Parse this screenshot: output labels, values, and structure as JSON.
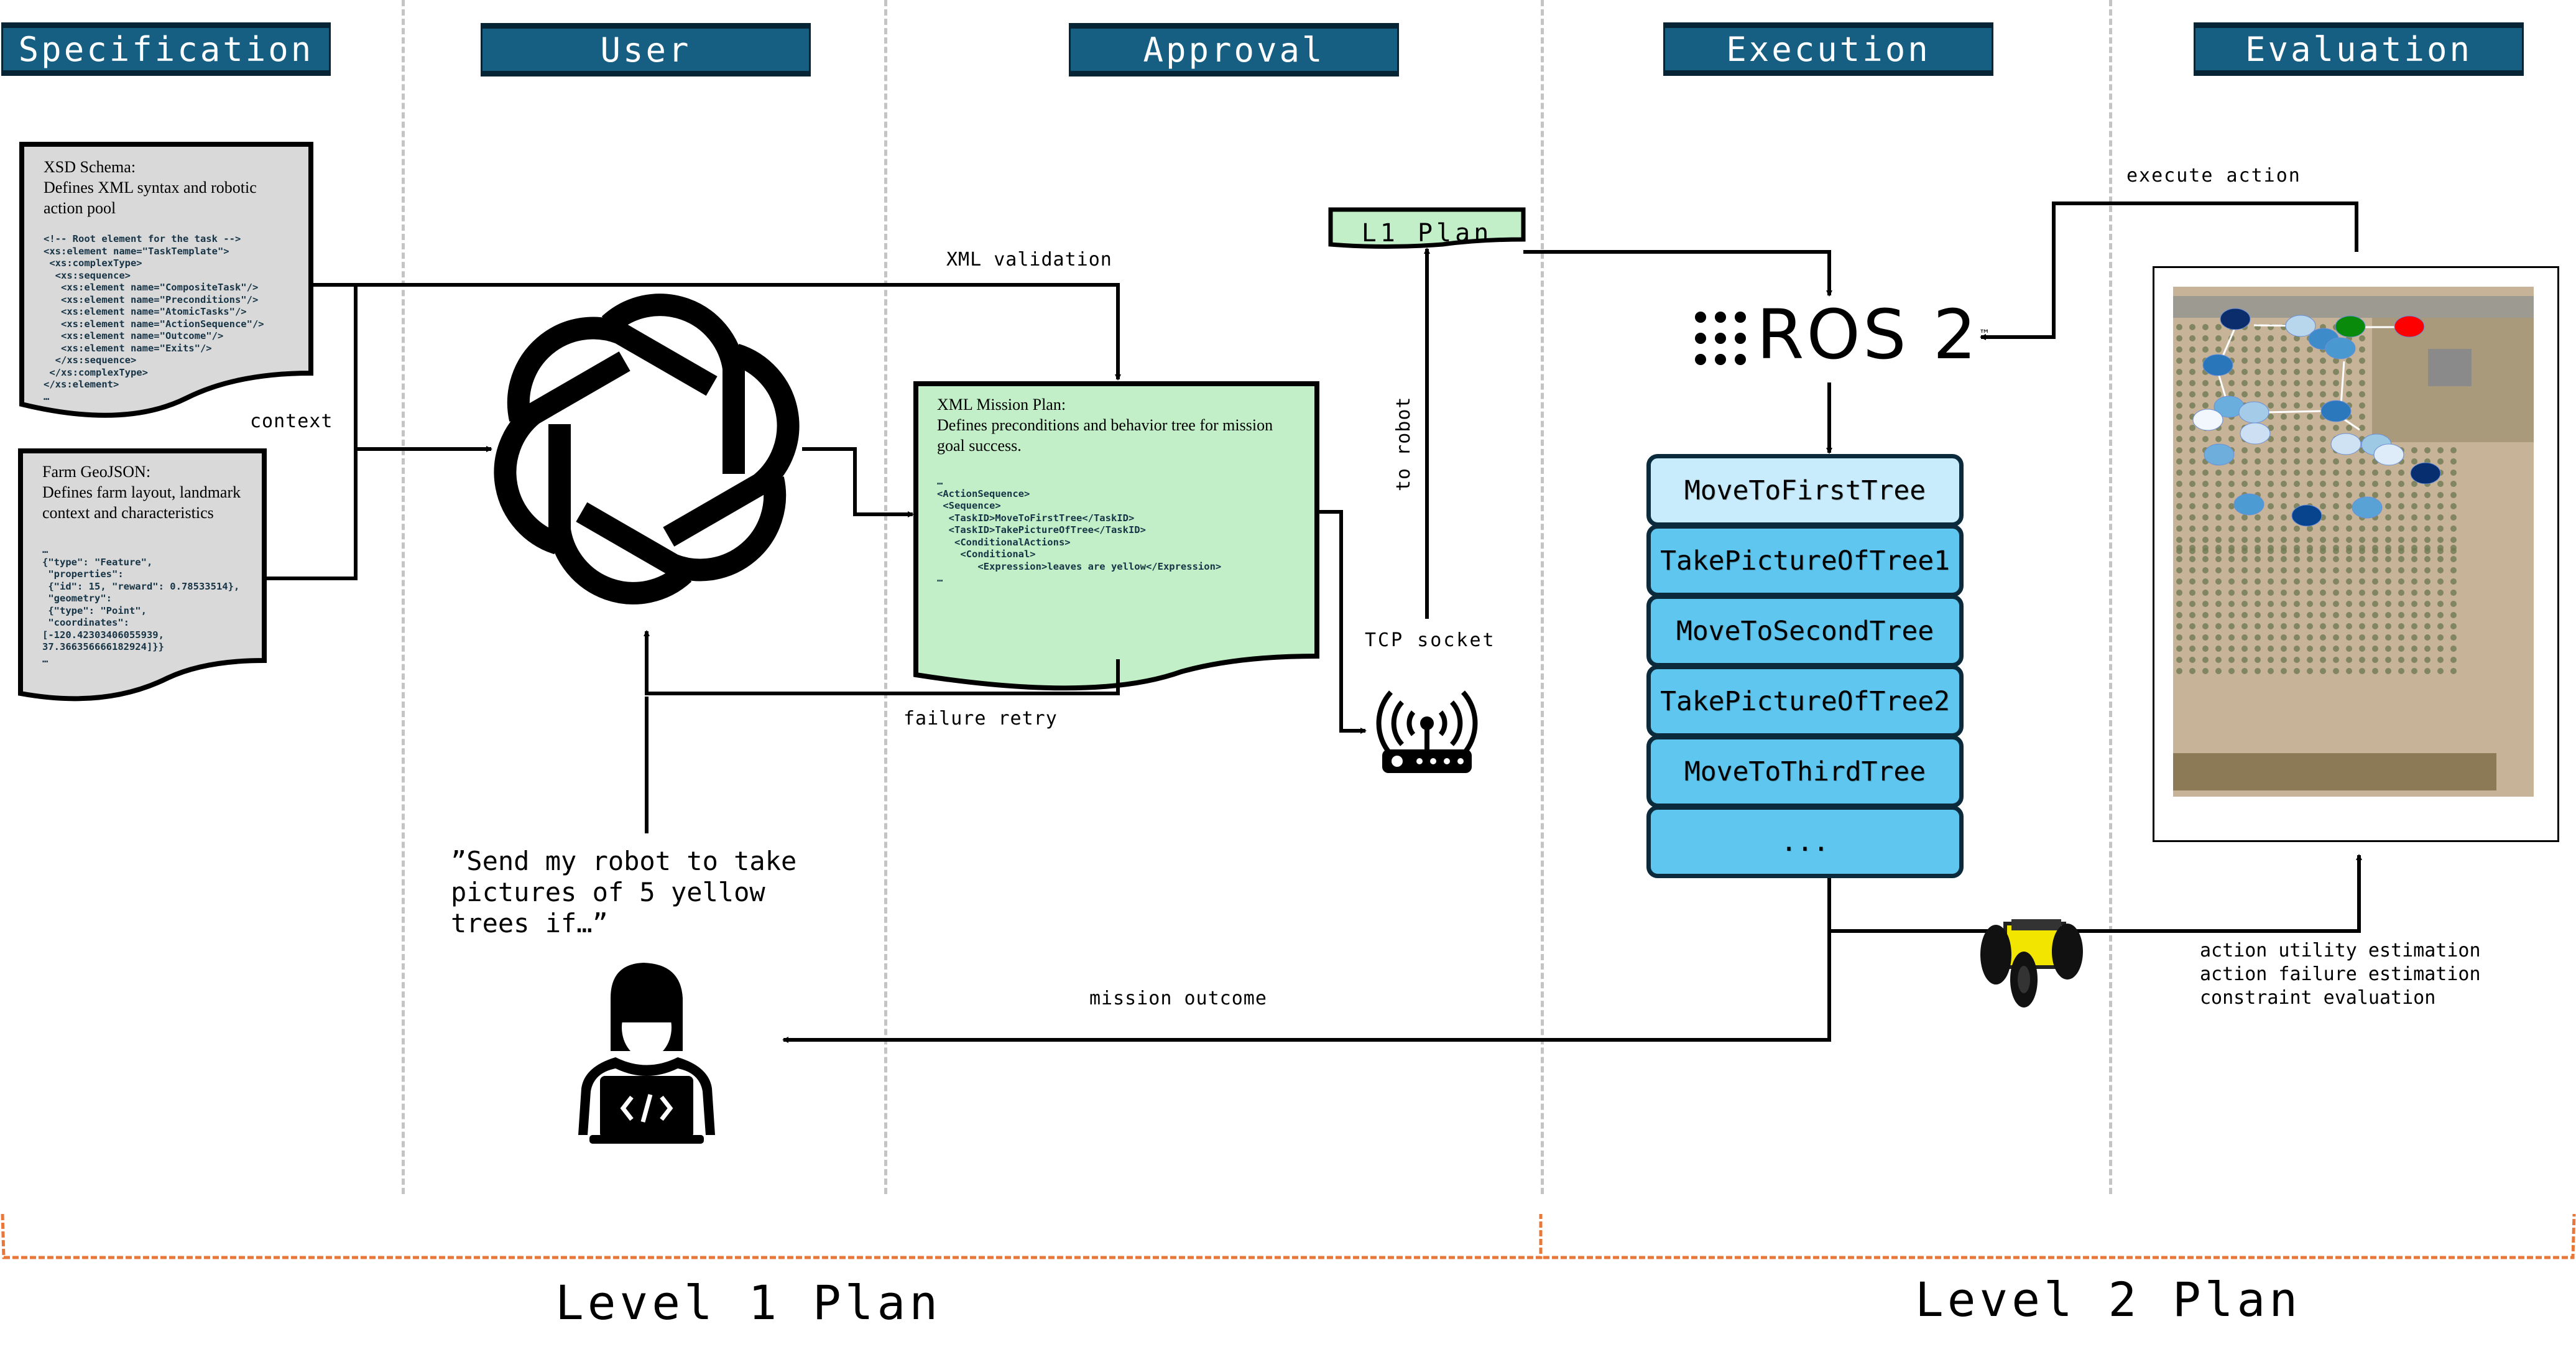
{
  "headers": {
    "specification": "Specification",
    "user": "User",
    "approval": "Approval",
    "execution": "Execution",
    "evaluation": "Evaluation"
  },
  "xsd_doc": {
    "title_line1": "XSD Schema:",
    "title_line2": "Defines XML syntax and robotic",
    "title_line3": "action pool",
    "code": "<!-- Root element for the task -->\n<xs:element name=\"TaskTemplate\">\n <xs:complexType>\n  <xs:sequence>\n   <xs:element name=\"CompositeTask\"/>\n   <xs:element name=\"Preconditions\"/>\n   <xs:element name=\"AtomicTasks\"/>\n   <xs:element name=\"ActionSequence\"/>\n   <xs:element name=\"Outcome\"/>\n   <xs:element name=\"Exits\"/>\n  </xs:sequence>\n </xs:complexType>\n</xs:element>\n…"
  },
  "geojson_doc": {
    "title_line1": "Farm GeoJSON:",
    "title_line2": "Defines farm layout, landmark",
    "title_line3": "context and characteristics",
    "code": "…\n{\"type\": \"Feature\",\n \"properties\":\n {\"id\": 15, \"reward\": 0.78533514},\n \"geometry\":\n {\"type\": \"Point\",\n \"coordinates\":\n[-120.42303406055939,\n37.366356666182924]}}\n…"
  },
  "mission_plan_doc": {
    "title_line1": "XML Mission Plan:",
    "title_line2": "Defines preconditions and behavior tree for mission",
    "title_line3": "goal success.",
    "code": "…\n<ActionSequence>\n <Sequence>\n  <TaskID>MoveToFirstTree</TaskID>\n  <TaskID>TakePictureOfTree</TaskID>\n   <ConditionalActions>\n    <Conditional>\n       <Expression>leaves are yellow</Expression>\n…"
  },
  "l1_plan": "L1 Plan",
  "labels": {
    "context": "context",
    "xml_validation": "XML validation",
    "failure_retry": "failure retry",
    "to_robot": "to robot",
    "tcp_socket": "TCP socket",
    "mission_outcome": "mission outcome",
    "execute_action": "execute action"
  },
  "user_prompt": "”Send my robot to take\npictures of 5 yellow\ntrees if…”",
  "ros2": {
    "text": "ROS 2",
    "tm": "™"
  },
  "action_stack": [
    {
      "label": "MoveToFirstTree",
      "active": true
    },
    {
      "label": "TakePictureOfTree1",
      "active": false
    },
    {
      "label": "MoveToSecondTree",
      "active": false
    },
    {
      "label": "TakePictureOfTree2",
      "active": false
    },
    {
      "label": "MoveToThirdTree",
      "active": false
    },
    {
      "label": "...",
      "active": false
    }
  ],
  "evaluation_metrics": "action utility estimation\naction failure estimation\nconstraint evaluation",
  "levels": {
    "level1": "Level 1 Plan",
    "level2": "Level 2 Plan"
  },
  "colors": {
    "header_bg": "#175f82",
    "header_border": "#062434",
    "doc_gray": "#d9d9d9",
    "doc_green": "#c2efc8",
    "stack_active": "#c8ecfb",
    "stack_row": "#5fc7ef",
    "bracket_orange": "#e8773a",
    "start_node": "#0a8a0a",
    "goal_node": "#ff0000"
  },
  "map_nodes": [
    {
      "id": "n1",
      "color": "#0b2d6b"
    },
    {
      "id": "n2",
      "color": "#b8d6ec"
    },
    {
      "id": "start",
      "color": "#0a8a0a"
    },
    {
      "id": "goal",
      "color": "#ff0000"
    },
    {
      "id": "n3",
      "color": "#3d8bc9"
    },
    {
      "id": "n4",
      "color": "#4a98d0"
    },
    {
      "id": "n5",
      "color": "#2a76bb"
    },
    {
      "id": "n6",
      "color": "#6aaede"
    },
    {
      "id": "n7",
      "color": "#f2f7fd"
    },
    {
      "id": "n8",
      "color": "#a4cbe8"
    },
    {
      "id": "n9",
      "color": "#cde0f3"
    },
    {
      "id": "n10",
      "color": "#2b78bc"
    },
    {
      "id": "n11",
      "color": "#cfe2f4"
    },
    {
      "id": "n12",
      "color": "#9ec9e5"
    },
    {
      "id": "n13",
      "color": "#deebf8"
    },
    {
      "id": "n14",
      "color": "#6eaedc"
    },
    {
      "id": "n15",
      "color": "#072e6e"
    },
    {
      "id": "n16",
      "color": "#4d9bd3"
    },
    {
      "id": "n17",
      "color": "#08438e"
    },
    {
      "id": "n18",
      "color": "#58a2d6"
    }
  ]
}
